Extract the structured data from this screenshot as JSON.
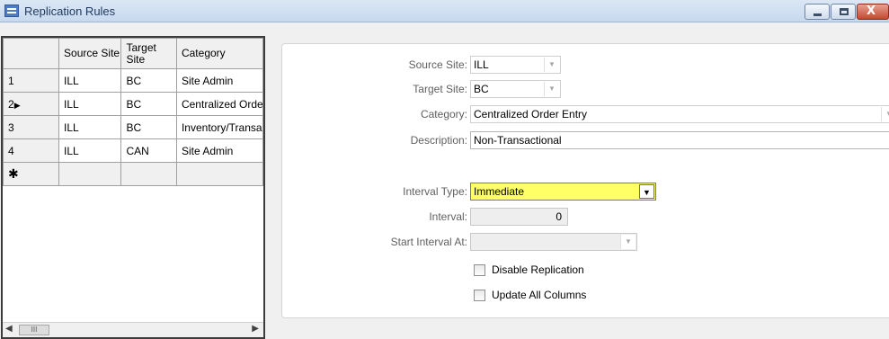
{
  "window": {
    "title": "Replication Rules"
  },
  "grid": {
    "columns": [
      "",
      "Source Site",
      "Target Site",
      "Category"
    ],
    "rows": [
      {
        "num": "1",
        "marker": "",
        "source": "ILL",
        "target": "BC",
        "category": "Site Admin"
      },
      {
        "num": "2",
        "marker": "▶",
        "source": "ILL",
        "target": "BC",
        "category": "Centralized Order Entry"
      },
      {
        "num": "3",
        "marker": "",
        "source": "ILL",
        "target": "BC",
        "category": "Inventory/Transactional"
      },
      {
        "num": "4",
        "marker": "",
        "source": "ILL",
        "target": "CAN",
        "category": "Site Admin"
      }
    ],
    "new_row_marker": "✱",
    "scroll_thumb_glyph": "III"
  },
  "form": {
    "source_site": {
      "label": "Source Site:",
      "value": "ILL"
    },
    "target_site": {
      "label": "Target Site:",
      "value": "BC"
    },
    "category": {
      "label": "Category:",
      "value": "Centralized Order Entry"
    },
    "description": {
      "label": "Description:",
      "value": "Non-Transactional"
    },
    "interval_type": {
      "label": "Interval Type:",
      "value": "Immediate"
    },
    "interval": {
      "label": "Interval:",
      "value": "0"
    },
    "start_interval_at": {
      "label": "Start Interval At:",
      "value": ""
    },
    "disable_replication": {
      "label": "Disable Replication",
      "checked": false
    },
    "update_all_columns": {
      "label": "Update All Columns",
      "checked": false
    }
  },
  "colors": {
    "highlight": "#ffff66",
    "titlebar": "#c7d8ee"
  },
  "icons": {
    "dropdown": "▼",
    "scroll_left": "◀",
    "scroll_right": "▶",
    "close": "X"
  }
}
